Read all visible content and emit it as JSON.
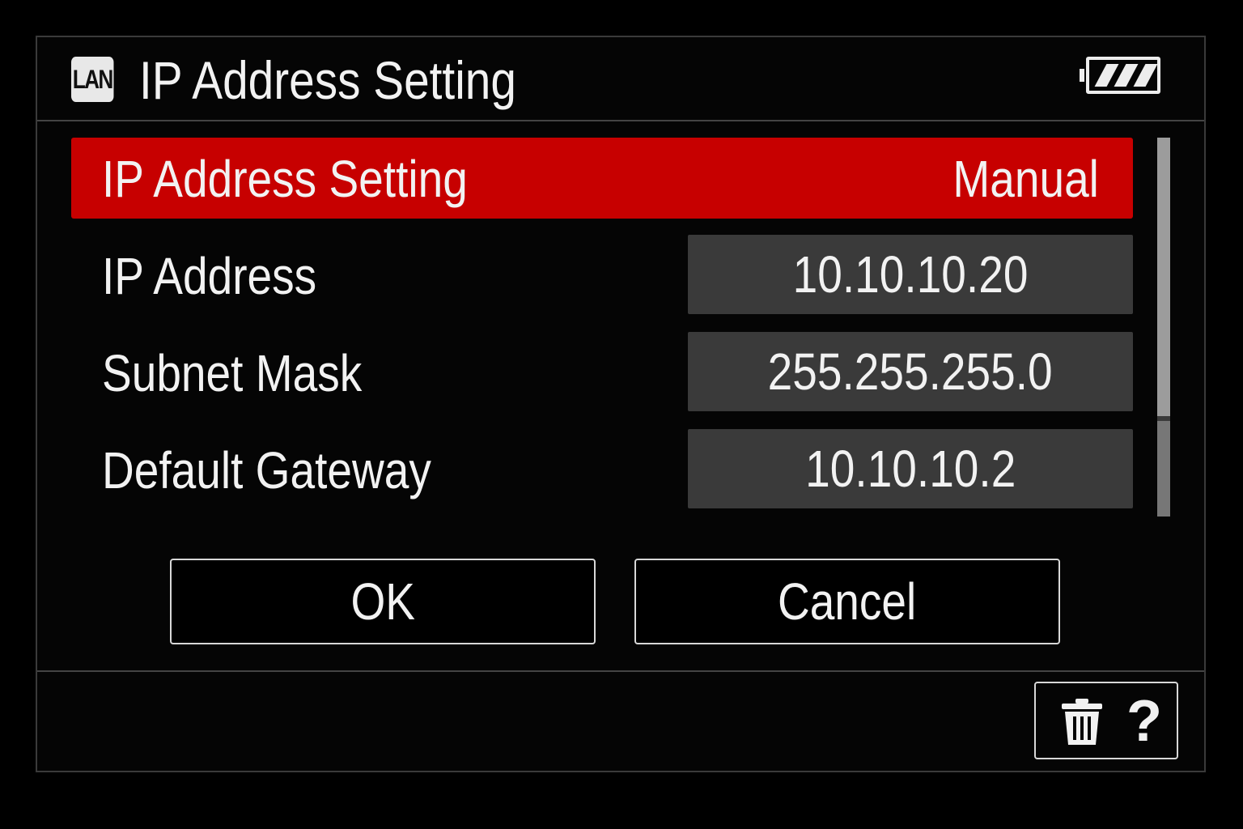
{
  "header": {
    "badge": "LAN",
    "title": "IP Address Setting",
    "battery_icon": "battery-full-icon"
  },
  "menu": {
    "items": [
      {
        "label": "IP Address Setting",
        "value": "Manual"
      },
      {
        "label": "IP Address",
        "value": "10.10.10.20"
      },
      {
        "label": "Subnet Mask",
        "value": "255.255.255.0"
      },
      {
        "label": "Default Gateway",
        "value": "10.10.10.2"
      }
    ]
  },
  "buttons": {
    "ok": "OK",
    "cancel": "Cancel"
  },
  "footer": {
    "delete_icon": "trash-icon",
    "help_glyph": "?"
  },
  "colors": {
    "highlight": "#c70000",
    "value_box": "#3a3a3a",
    "background": "#000000",
    "text": "#f2f2f2"
  }
}
